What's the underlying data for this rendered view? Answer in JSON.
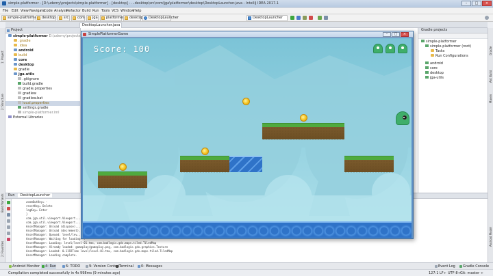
{
  "window": {
    "title": "simple-platformer - [D:\\udemy\\projects\\simple-platformer] - [desktop] - ...desktop\\src\\com\\jga\\platformer\\desktop\\DesktopLauncher.java - IntelliJ IDEA 2017.1"
  },
  "menu": [
    "File",
    "Edit",
    "View",
    "Navigate",
    "Code",
    "Analyze",
    "Refactor",
    "Build",
    "Run",
    "Tools",
    "VCS",
    "Window",
    "Help"
  ],
  "breadcrumbs": [
    "simple-platformer",
    "desktop",
    "src",
    "com",
    "jga",
    "platformer",
    "desktop",
    "DesktopLauncher"
  ],
  "toolbar": {
    "run_config": "DesktopLauncher"
  },
  "editor_tabs": [
    "DesktopLauncher.java"
  ],
  "project": {
    "header": "Project",
    "root": "simple-platformer",
    "root_path": "D:\\udemy\\projects\\s",
    "items": [
      ".gradle",
      ".idea",
      "android",
      "build",
      "core",
      "desktop",
      "gradle",
      "jga-utils",
      ".gitignore",
      "build.gradle",
      "gradle.properties",
      "gradlew",
      "gradlew.bat",
      "local.properties",
      "settings.gradle",
      "simple-platformer.iml"
    ],
    "external": "External Libraries"
  },
  "gradle": {
    "header": "Gradle projects",
    "items": [
      "simple-platformer",
      "simple-platformer (root)",
      "Tasks",
      "Run Configurations",
      "android",
      "core",
      "desktop",
      "jga-utils"
    ]
  },
  "game": {
    "window_title": "SimplePlatformerGame",
    "score_text": "Score: 100"
  },
  "run": {
    "header": "Run",
    "tab": "DesktopLauncher",
    "lines": [
      "zoomOutKey= -",
      "resetKey= Delete",
      "logKey= Enter",
      "}",
      "com.jga.util.viewport.Viewport...",
      "com.jga.util.viewport.Viewport...",
      "AssetManager: Unload (dispose)...",
      "AssetManager: Unload (decrement)...",
      "AssetManager: Queued: level/lev...",
      "AssetManager: Waiting for loading...",
      "AssetManager: Loading: level/level-01.tmx, com.badlogic.gdx.maps.tiled.TiledMap",
      "AssetManager: Already loaded: gameplay/gameplay.png, com.badlogic.gdx.graphics.Texture",
      "AssetManager: Loaded: 0.1192Time level/level-01.tmx, com.badlogic.gdx.maps.tiled.TiledMap",
      "AssetManager: Loading complete."
    ]
  },
  "bottom_tabs": [
    "Android Monitor",
    "4: Run",
    "6: TODO",
    "9: Version Control",
    "Terminal",
    "0: Messages"
  ],
  "bottom_right_tabs": [
    "Event Log",
    "Gradle Console"
  ],
  "status": {
    "message": "Compilation completed successfully in 4s 998ms (9 minutes ago)",
    "position": "127:1",
    "line_sep": "LF÷",
    "encoding": "UTF-8÷",
    "branch": "Git: master ÷"
  },
  "left_strip": [
    "1: Project",
    "2: Structure",
    "Build Variants",
    "2: Favorites"
  ],
  "right_strip": [
    "Gradle",
    "Ant Build",
    "Maven",
    "Android Model"
  ]
}
